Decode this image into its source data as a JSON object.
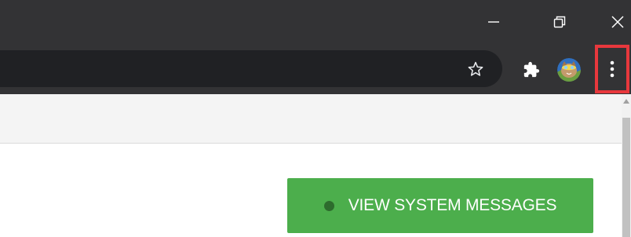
{
  "window": {
    "title_bar_color": "#333335",
    "controls": [
      "minimize-icon",
      "restore-icon",
      "close-icon"
    ]
  },
  "toolbar": {
    "icons": [
      "star-icon",
      "puzzle-extensions-icon",
      "profile-avatar",
      "kebab-menu-icon"
    ],
    "menu_highlight_color": "#e8383d"
  },
  "page": {
    "action_button": {
      "label": "VIEW SYSTEM MESSAGES",
      "background": "#4cae4c",
      "indicator_color": "#2d6b2d"
    }
  }
}
